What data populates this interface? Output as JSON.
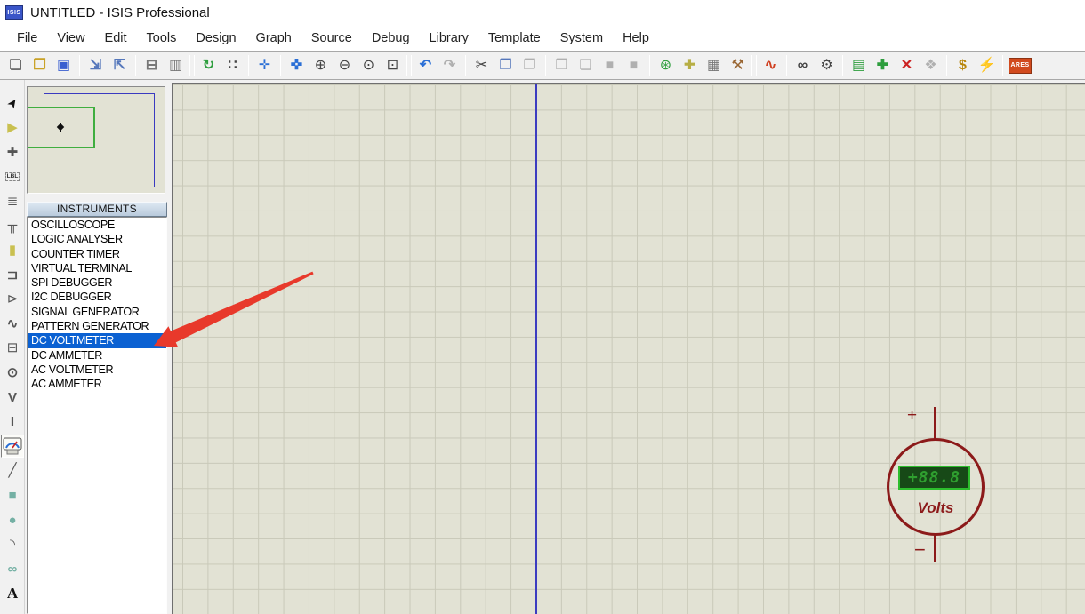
{
  "window": {
    "title": "UNTITLED - ISIS Professional",
    "app_icon_label": "ISIS"
  },
  "menu": {
    "items": [
      "File",
      "View",
      "Edit",
      "Tools",
      "Design",
      "Graph",
      "Source",
      "Debug",
      "Library",
      "Template",
      "System",
      "Help"
    ]
  },
  "toolbar": {
    "glyphs": {
      "new_file": "❏",
      "open": "❐",
      "save": "▣",
      "import_section": "⇲",
      "export_section": "⇱",
      "print": "⊟",
      "mark_output": "▥",
      "redraw": "↻",
      "grid_toggle": "∷",
      "origin": "✛",
      "pan": "✜",
      "zoom_in": "⊕",
      "zoom_out": "⊖",
      "zoom_all": "⊙",
      "zoom_area": "⊡",
      "undo": "↶",
      "redo": "↷",
      "cut": "✂",
      "copy": "❒",
      "paste": "❐",
      "block_copy": "❒",
      "block_move": "❏",
      "block_rotate": "■",
      "block_delete": "■",
      "pick_parts": "⊛",
      "make_device": "✚",
      "packaging": "▦",
      "decompose": "⚒",
      "autoroute": "∿",
      "search_tag": "∞",
      "property_tool": "⚙",
      "design_explorer": "▤",
      "new_sheet": "✚",
      "remove_sheet": "✕",
      "goto_sheet": "❖",
      "bom": "$",
      "erc": "⚡"
    },
    "ares_label": "ARES"
  },
  "sidebar": {
    "glyphs": {
      "selection": "➤",
      "component": "▶",
      "junction": "✚",
      "wire_label": "LBL",
      "text_script": "≣",
      "buses": "╥",
      "subcircuit": "▮",
      "terminals": "⊐",
      "device_pins": "⊳",
      "graph": "∿",
      "tape": "⊟",
      "generator": "⊙",
      "voltage_probe": "V",
      "current_probe": "I",
      "line_2d": "╱",
      "box_2d": "■",
      "circle_2d": "●",
      "arc_2d": "◝",
      "path_2d": "∞",
      "text_2d": "A"
    }
  },
  "panel": {
    "header": "INSTRUMENTS",
    "instruments": [
      "OSCILLOSCOPE",
      "LOGIC ANALYSER",
      "COUNTER TIMER",
      "VIRTUAL TERMINAL",
      "SPI DEBUGGER",
      "I2C DEBUGGER",
      "SIGNAL GENERATOR",
      "PATTERN GENERATOR",
      "DC VOLTMETER",
      "DC AMMETER",
      "AC VOLTMETER",
      "AC AMMETER"
    ],
    "selected_index": 8,
    "selected_instrument": "DC VOLTMETER"
  },
  "canvas": {
    "voltmeter": {
      "display_value": "+88.8",
      "unit_label": "Volts",
      "plus_label": "+",
      "minus_label": "−"
    }
  },
  "colors": {
    "canvas_bg": "#e2e2d4",
    "grid_line": "#c9c9b9",
    "sheet_border": "#3c3cc0",
    "overview_sheet": "#3a3ac0",
    "overview_viewport": "#3fae3f",
    "selection_highlight": "#0b61d2",
    "voltmeter_outline": "#8c1a1a",
    "display_border": "#2dbd2d",
    "display_bg": "#174917",
    "display_text": "#2f9f2f",
    "annotation_arrow": "#e8392b",
    "ares_orange": "#d14a1e"
  }
}
